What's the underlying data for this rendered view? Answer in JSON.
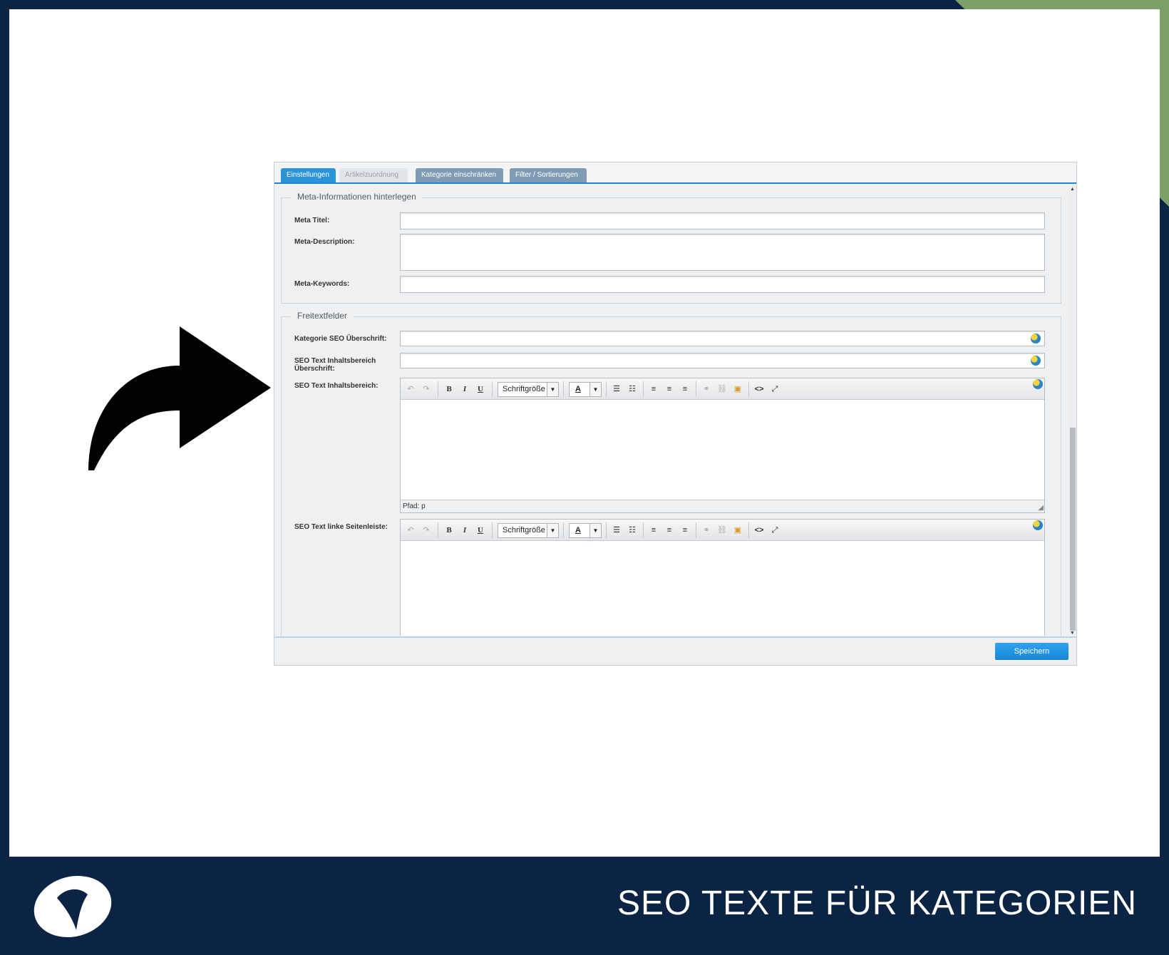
{
  "tabs": [
    "Einstellungen",
    "Artikelzuordnung",
    "Kategorie einschränken",
    "Filter / Sortierungen"
  ],
  "meta_section": {
    "legend": "Meta-Informationen hinterlegen",
    "fields": [
      "Meta Titel:",
      "Meta-Description:",
      "Meta-Keywords:"
    ]
  },
  "freitext_section": {
    "legend": "Freitextfelder",
    "fields": [
      "Kategorie SEO Überschrift:",
      "SEO Text Inhaltsbereich Überschrift:",
      "SEO Text Inhaltsbereich:",
      "SEO Text linke Seitenleiste:"
    ]
  },
  "editor": {
    "font_size_select": "Schriftgröße",
    "path_label": "Pfad: p",
    "toolbar_icons": [
      "undo-icon",
      "redo-icon",
      "bold-icon",
      "italic-icon",
      "underline-icon",
      "text-color-icon",
      "bullet-list-icon",
      "numbered-list-icon",
      "align-left-icon",
      "align-center-icon",
      "align-right-icon",
      "link-icon",
      "unlink-icon",
      "image-icon",
      "source-code-icon",
      "fullscreen-icon"
    ]
  },
  "save_label": "Speichern",
  "page_title": "SEO TEXTE FÜR KATEGORIEN",
  "colors": {
    "background": "#0c2444",
    "accent_green": "#7da068",
    "tab_active": "#2b94d9",
    "save_button": "#1a86d6"
  }
}
